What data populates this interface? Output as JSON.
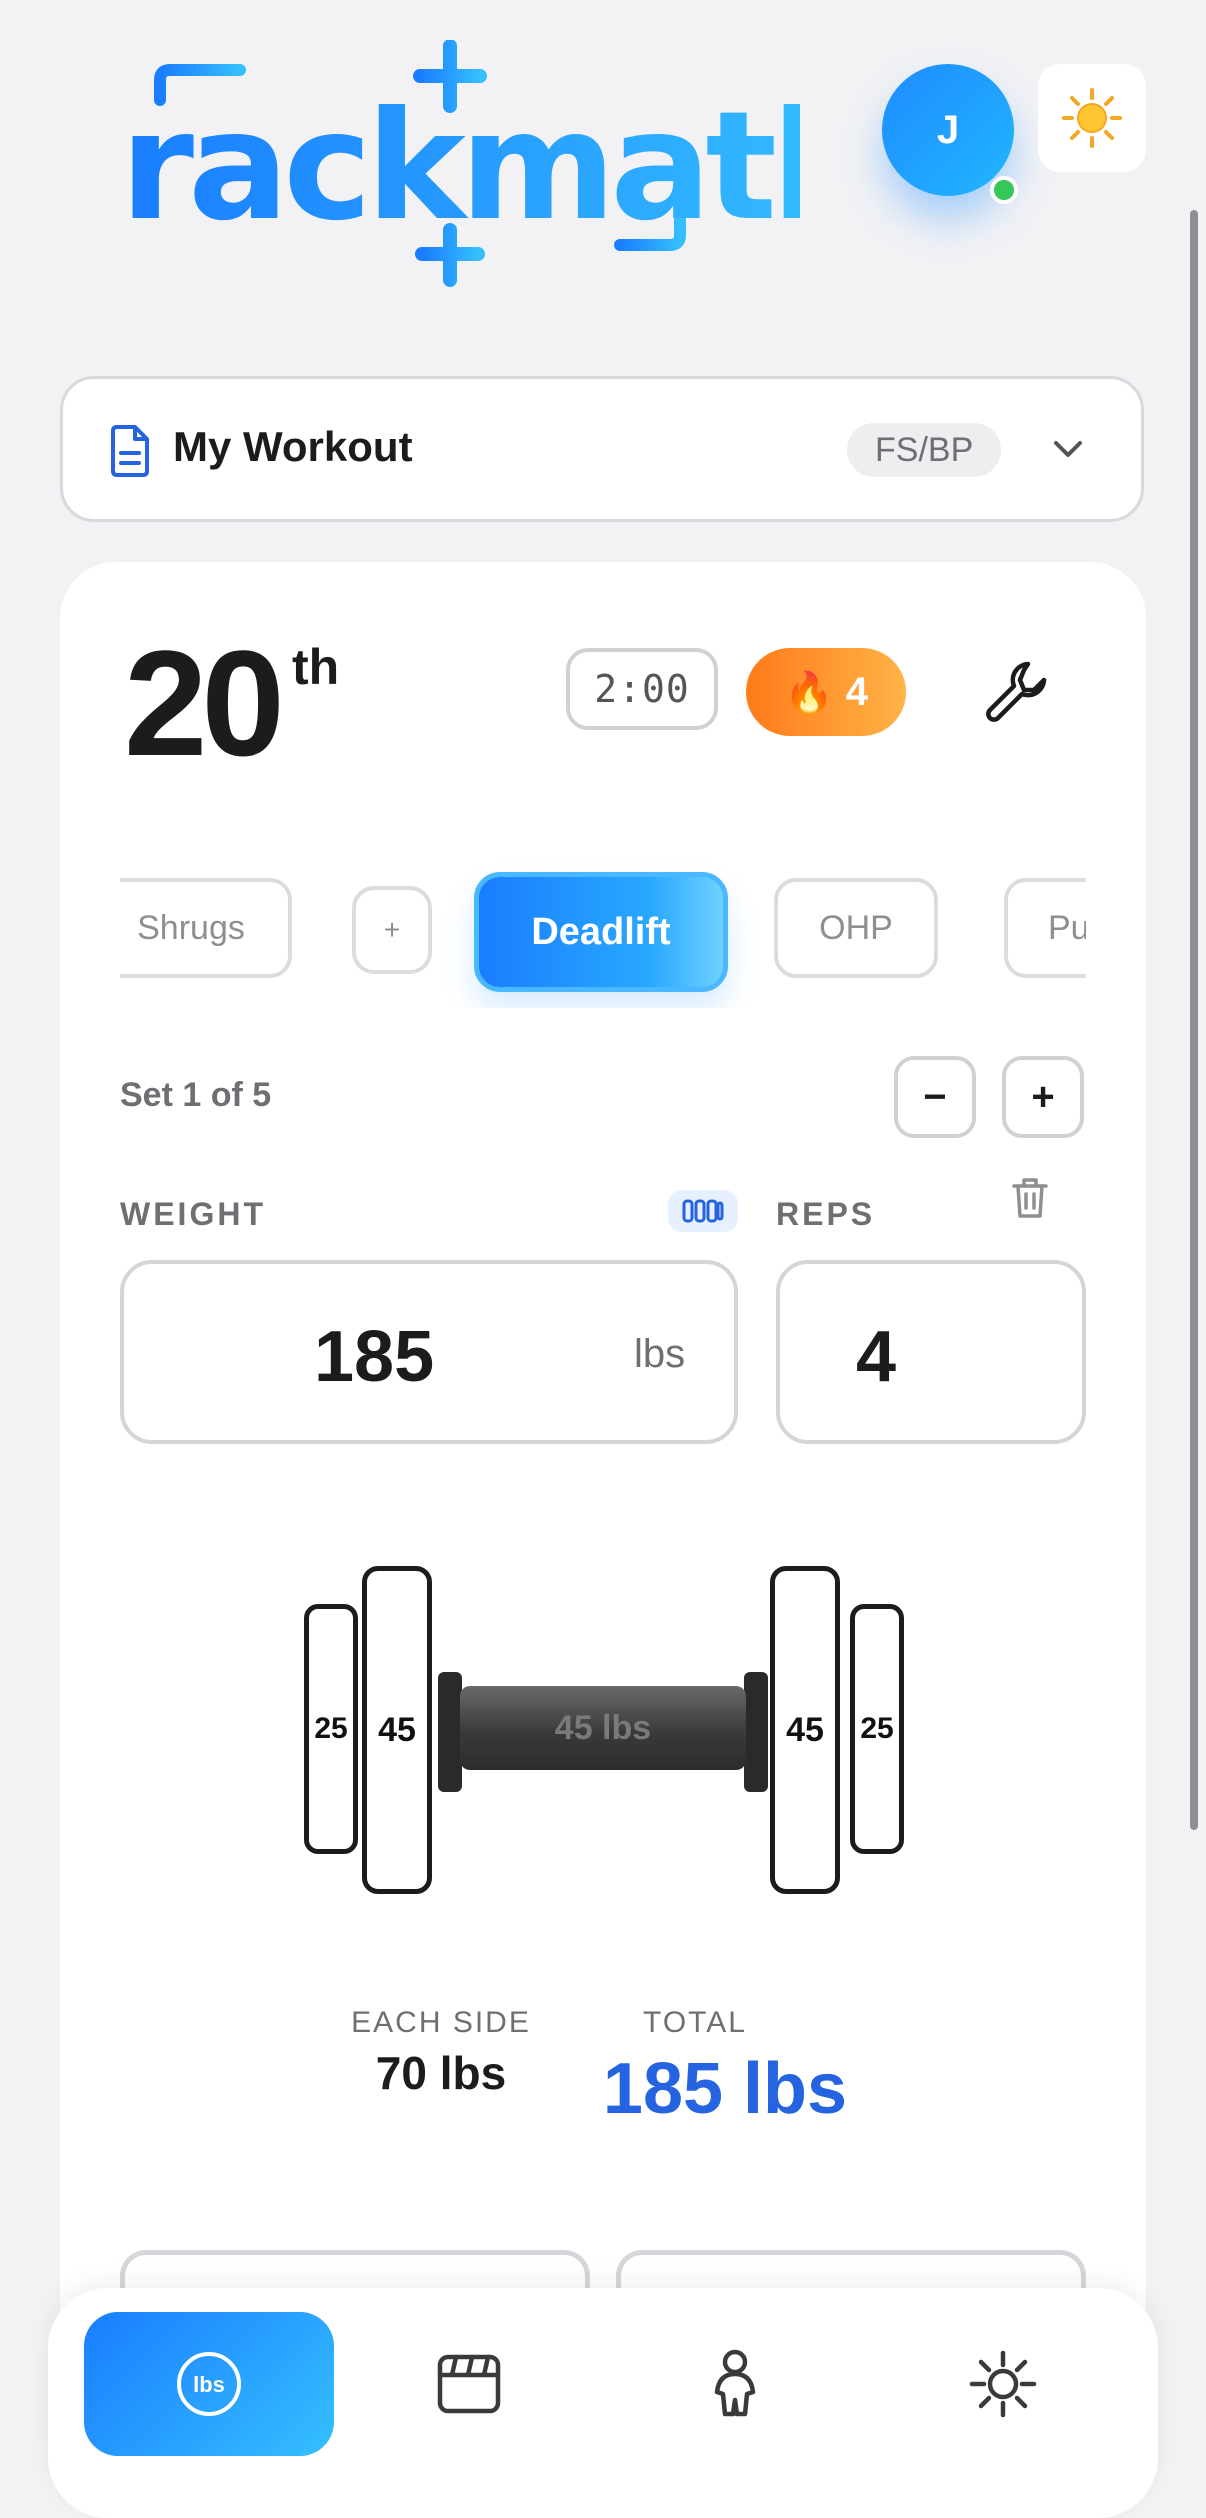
{
  "header": {
    "logo_text": "rackmath",
    "avatar_initial": "J",
    "theme_icon": "sun-icon"
  },
  "workout_selector": {
    "name": "My Workout",
    "tag": "FS/BP",
    "doc_icon": "document-icon",
    "chevron_icon": "chevron-down-icon"
  },
  "session": {
    "day_number": "20",
    "day_suffix": "th",
    "timer": "2:00",
    "streak_emoji": "🔥",
    "streak_count": "4",
    "settings_icon": "wrench-icon"
  },
  "exercise_tabs": {
    "items": [
      "Shrugs",
      "+",
      "Deadlift",
      "OHP",
      "Pu"
    ],
    "active": "Deadlift"
  },
  "set": {
    "label": "Set 1 of 5",
    "minus_label": "−",
    "plus_label": "+"
  },
  "weight": {
    "label": "WEIGHT",
    "value": "185",
    "unit": "lbs"
  },
  "reps": {
    "label": "REPS",
    "value": "4"
  },
  "barbell": {
    "bar_label": "45 lbs",
    "plates_left": [
      "25",
      "45"
    ],
    "plates_right": [
      "45",
      "25"
    ]
  },
  "summary": {
    "each_side_label": "EACH SIDE",
    "each_side_value": "70 lbs",
    "total_label": "TOTAL",
    "total_value": "185 lbs"
  },
  "bottom_nav": {
    "items": [
      {
        "name": "calculator",
        "icon": "lbs-circle-icon",
        "icon_text": "lbs",
        "active": true
      },
      {
        "name": "calendar",
        "icon": "calendar-icon",
        "active": false
      },
      {
        "name": "profile",
        "icon": "person-icon",
        "active": false
      },
      {
        "name": "settings",
        "icon": "gear-icon",
        "active": false
      }
    ]
  },
  "colors": {
    "accent": "#1a7dff",
    "total_blue": "#2563e0",
    "streak_orange": "#ff7a1a",
    "online_green": "#34c759"
  }
}
